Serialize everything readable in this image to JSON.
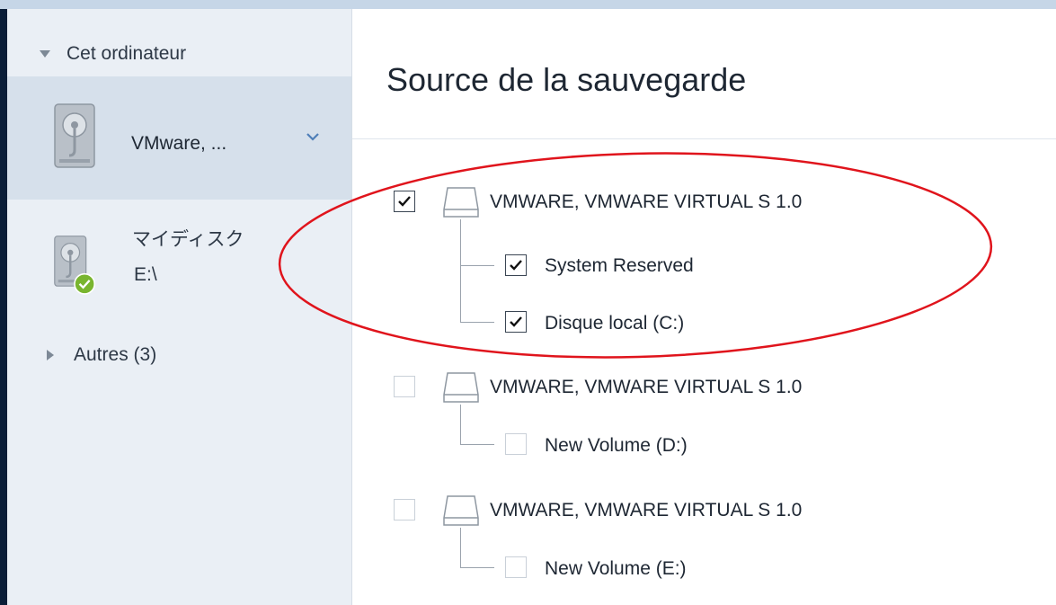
{
  "sidebar": {
    "header": "Cet ordinateur",
    "items": [
      {
        "label": "VMware, ...",
        "selected": true,
        "icon": "hard-drive-icon"
      },
      {
        "label_line1": "マイディスク",
        "label_line2": "E:\\",
        "icon": "hard-drive-check-icon"
      }
    ],
    "others": "Autres (3)"
  },
  "main": {
    "title": "Source de la sauvegarde",
    "disks": [
      {
        "label": "VMWARE, VMWARE VIRTUAL S 1.0",
        "checked": true,
        "volumes": [
          {
            "label": "System Reserved",
            "checked": true
          },
          {
            "label": "Disque local (C:)",
            "checked": true
          }
        ]
      },
      {
        "label": "VMWARE, VMWARE VIRTUAL S 1.0",
        "checked": false,
        "volumes": [
          {
            "label": "New Volume (D:)",
            "checked": false
          }
        ]
      },
      {
        "label": "VMWARE, VMWARE VIRTUAL S 1.0",
        "checked": false,
        "volumes": [
          {
            "label": "New Volume (E:)",
            "checked": false
          }
        ]
      }
    ]
  },
  "colors": {
    "annotation_ellipse": "#e0141c",
    "success_badge": "#79b52f",
    "sidebar_bg": "#eaeff5",
    "sidebar_selected": "#d6e0eb"
  }
}
